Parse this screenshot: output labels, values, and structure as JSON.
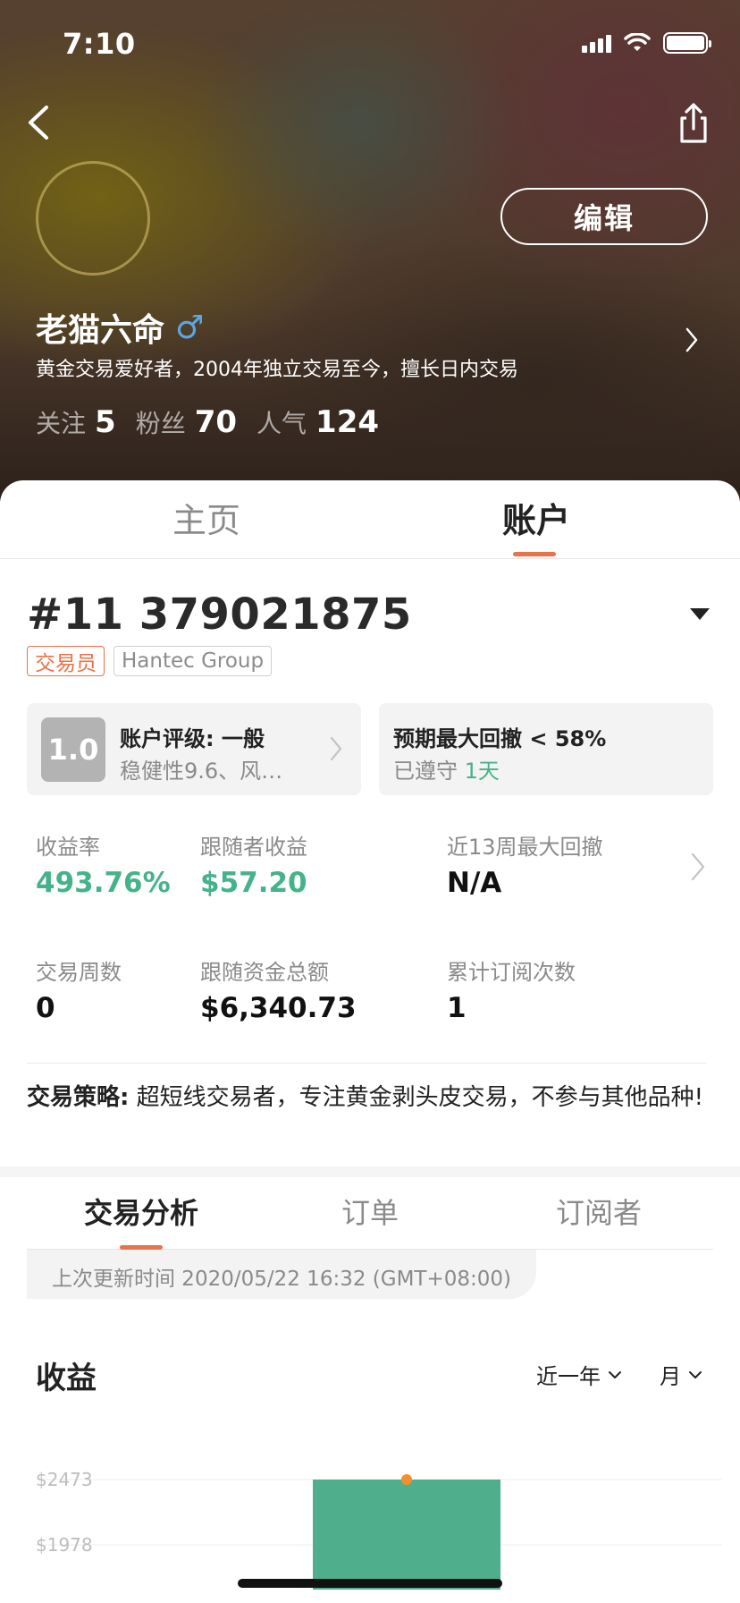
{
  "status_bar": {
    "time": "7:10"
  },
  "header": {
    "edit_label": "编辑",
    "username": "老猫六命",
    "gender_symbol": "♂",
    "bio": "黄金交易爱好者，2004年独立交易至今，擅长日内交易",
    "stats": [
      {
        "label": "关注",
        "value": "5"
      },
      {
        "label": "粉丝",
        "value": "70"
      },
      {
        "label": "人气",
        "value": "124"
      }
    ]
  },
  "top_tabs": {
    "home": "主页",
    "account": "账户",
    "active": "account"
  },
  "account": {
    "id": "#11 379021875",
    "badges": {
      "role": "交易员",
      "broker": "Hantec Group"
    },
    "rating_card": {
      "score": "1.0",
      "title": "账户评级: 一般",
      "subtitle": "稳健性9.6、风…"
    },
    "drawdown_card": {
      "title": "预期最大回撤 < 58%",
      "status_prefix": "已遵守",
      "status_days": "1天"
    },
    "metrics": [
      {
        "label": "收益率",
        "value": "493.76%",
        "highlight": true
      },
      {
        "label": "跟随者收益",
        "value": "$57.20",
        "highlight": true
      },
      {
        "label": "近13周最大回撤",
        "value": "N/A",
        "highlight": false
      },
      {
        "label": "交易周数",
        "value": "0",
        "highlight": false
      },
      {
        "label": "跟随资金总额",
        "value": "$6,340.73",
        "highlight": false
      },
      {
        "label": "累计订阅次数",
        "value": "1",
        "highlight": false
      }
    ],
    "strategy": {
      "label": "交易策略:",
      "text": "超短线交易者，专注黄金剥头皮交易，不参与其他品种!"
    }
  },
  "sub_tabs": {
    "analysis": "交易分析",
    "orders": "订单",
    "subscribers": "订阅者",
    "active": "analysis"
  },
  "last_update": "上次更新时间 2020/05/22 16:32 (GMT+08:00)",
  "earnings": {
    "title": "收益",
    "period": "近一年",
    "unit": "月"
  },
  "chart_data": {
    "type": "bar",
    "y_ticks": [
      "$2473",
      "$1978"
    ],
    "values": [
      2473
    ],
    "grid": true
  },
  "colors": {
    "accent": "#e8734a",
    "positive": "#45b38a",
    "bar": "#4fae8c",
    "bar_marker": "#f0902f",
    "gender": "#5aa6e8"
  },
  "icons": {
    "back": "chevron-left-icon",
    "share": "share-icon",
    "dropdown": "caret-down-icon"
  }
}
